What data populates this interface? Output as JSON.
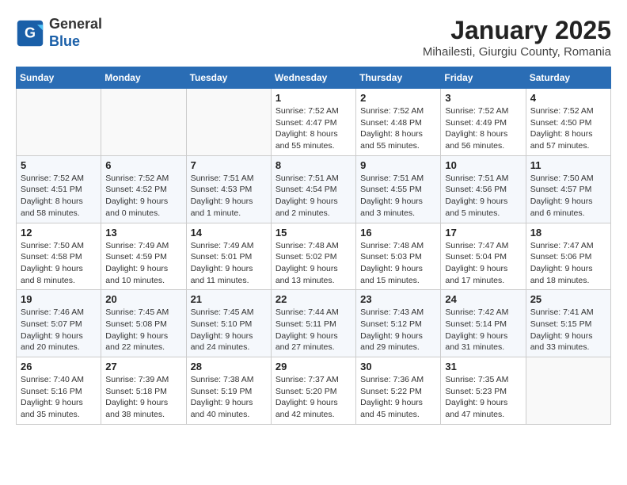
{
  "header": {
    "logo_general": "General",
    "logo_blue": "Blue",
    "month_title": "January 2025",
    "location": "Mihailesti, Giurgiu County, Romania"
  },
  "weekdays": [
    "Sunday",
    "Monday",
    "Tuesday",
    "Wednesday",
    "Thursday",
    "Friday",
    "Saturday"
  ],
  "weeks": [
    [
      {
        "day": "",
        "sunrise": "",
        "sunset": "",
        "daylight": ""
      },
      {
        "day": "",
        "sunrise": "",
        "sunset": "",
        "daylight": ""
      },
      {
        "day": "",
        "sunrise": "",
        "sunset": "",
        "daylight": ""
      },
      {
        "day": "1",
        "sunrise": "Sunrise: 7:52 AM",
        "sunset": "Sunset: 4:47 PM",
        "daylight": "Daylight: 8 hours and 55 minutes."
      },
      {
        "day": "2",
        "sunrise": "Sunrise: 7:52 AM",
        "sunset": "Sunset: 4:48 PM",
        "daylight": "Daylight: 8 hours and 55 minutes."
      },
      {
        "day": "3",
        "sunrise": "Sunrise: 7:52 AM",
        "sunset": "Sunset: 4:49 PM",
        "daylight": "Daylight: 8 hours and 56 minutes."
      },
      {
        "day": "4",
        "sunrise": "Sunrise: 7:52 AM",
        "sunset": "Sunset: 4:50 PM",
        "daylight": "Daylight: 8 hours and 57 minutes."
      }
    ],
    [
      {
        "day": "5",
        "sunrise": "Sunrise: 7:52 AM",
        "sunset": "Sunset: 4:51 PM",
        "daylight": "Daylight: 8 hours and 58 minutes."
      },
      {
        "day": "6",
        "sunrise": "Sunrise: 7:52 AM",
        "sunset": "Sunset: 4:52 PM",
        "daylight": "Daylight: 9 hours and 0 minutes."
      },
      {
        "day": "7",
        "sunrise": "Sunrise: 7:51 AM",
        "sunset": "Sunset: 4:53 PM",
        "daylight": "Daylight: 9 hours and 1 minute."
      },
      {
        "day": "8",
        "sunrise": "Sunrise: 7:51 AM",
        "sunset": "Sunset: 4:54 PM",
        "daylight": "Daylight: 9 hours and 2 minutes."
      },
      {
        "day": "9",
        "sunrise": "Sunrise: 7:51 AM",
        "sunset": "Sunset: 4:55 PM",
        "daylight": "Daylight: 9 hours and 3 minutes."
      },
      {
        "day": "10",
        "sunrise": "Sunrise: 7:51 AM",
        "sunset": "Sunset: 4:56 PM",
        "daylight": "Daylight: 9 hours and 5 minutes."
      },
      {
        "day": "11",
        "sunrise": "Sunrise: 7:50 AM",
        "sunset": "Sunset: 4:57 PM",
        "daylight": "Daylight: 9 hours and 6 minutes."
      }
    ],
    [
      {
        "day": "12",
        "sunrise": "Sunrise: 7:50 AM",
        "sunset": "Sunset: 4:58 PM",
        "daylight": "Daylight: 9 hours and 8 minutes."
      },
      {
        "day": "13",
        "sunrise": "Sunrise: 7:49 AM",
        "sunset": "Sunset: 4:59 PM",
        "daylight": "Daylight: 9 hours and 10 minutes."
      },
      {
        "day": "14",
        "sunrise": "Sunrise: 7:49 AM",
        "sunset": "Sunset: 5:01 PM",
        "daylight": "Daylight: 9 hours and 11 minutes."
      },
      {
        "day": "15",
        "sunrise": "Sunrise: 7:48 AM",
        "sunset": "Sunset: 5:02 PM",
        "daylight": "Daylight: 9 hours and 13 minutes."
      },
      {
        "day": "16",
        "sunrise": "Sunrise: 7:48 AM",
        "sunset": "Sunset: 5:03 PM",
        "daylight": "Daylight: 9 hours and 15 minutes."
      },
      {
        "day": "17",
        "sunrise": "Sunrise: 7:47 AM",
        "sunset": "Sunset: 5:04 PM",
        "daylight": "Daylight: 9 hours and 17 minutes."
      },
      {
        "day": "18",
        "sunrise": "Sunrise: 7:47 AM",
        "sunset": "Sunset: 5:06 PM",
        "daylight": "Daylight: 9 hours and 18 minutes."
      }
    ],
    [
      {
        "day": "19",
        "sunrise": "Sunrise: 7:46 AM",
        "sunset": "Sunset: 5:07 PM",
        "daylight": "Daylight: 9 hours and 20 minutes."
      },
      {
        "day": "20",
        "sunrise": "Sunrise: 7:45 AM",
        "sunset": "Sunset: 5:08 PM",
        "daylight": "Daylight: 9 hours and 22 minutes."
      },
      {
        "day": "21",
        "sunrise": "Sunrise: 7:45 AM",
        "sunset": "Sunset: 5:10 PM",
        "daylight": "Daylight: 9 hours and 24 minutes."
      },
      {
        "day": "22",
        "sunrise": "Sunrise: 7:44 AM",
        "sunset": "Sunset: 5:11 PM",
        "daylight": "Daylight: 9 hours and 27 minutes."
      },
      {
        "day": "23",
        "sunrise": "Sunrise: 7:43 AM",
        "sunset": "Sunset: 5:12 PM",
        "daylight": "Daylight: 9 hours and 29 minutes."
      },
      {
        "day": "24",
        "sunrise": "Sunrise: 7:42 AM",
        "sunset": "Sunset: 5:14 PM",
        "daylight": "Daylight: 9 hours and 31 minutes."
      },
      {
        "day": "25",
        "sunrise": "Sunrise: 7:41 AM",
        "sunset": "Sunset: 5:15 PM",
        "daylight": "Daylight: 9 hours and 33 minutes."
      }
    ],
    [
      {
        "day": "26",
        "sunrise": "Sunrise: 7:40 AM",
        "sunset": "Sunset: 5:16 PM",
        "daylight": "Daylight: 9 hours and 35 minutes."
      },
      {
        "day": "27",
        "sunrise": "Sunrise: 7:39 AM",
        "sunset": "Sunset: 5:18 PM",
        "daylight": "Daylight: 9 hours and 38 minutes."
      },
      {
        "day": "28",
        "sunrise": "Sunrise: 7:38 AM",
        "sunset": "Sunset: 5:19 PM",
        "daylight": "Daylight: 9 hours and 40 minutes."
      },
      {
        "day": "29",
        "sunrise": "Sunrise: 7:37 AM",
        "sunset": "Sunset: 5:20 PM",
        "daylight": "Daylight: 9 hours and 42 minutes."
      },
      {
        "day": "30",
        "sunrise": "Sunrise: 7:36 AM",
        "sunset": "Sunset: 5:22 PM",
        "daylight": "Daylight: 9 hours and 45 minutes."
      },
      {
        "day": "31",
        "sunrise": "Sunrise: 7:35 AM",
        "sunset": "Sunset: 5:23 PM",
        "daylight": "Daylight: 9 hours and 47 minutes."
      },
      {
        "day": "",
        "sunrise": "",
        "sunset": "",
        "daylight": ""
      }
    ]
  ]
}
